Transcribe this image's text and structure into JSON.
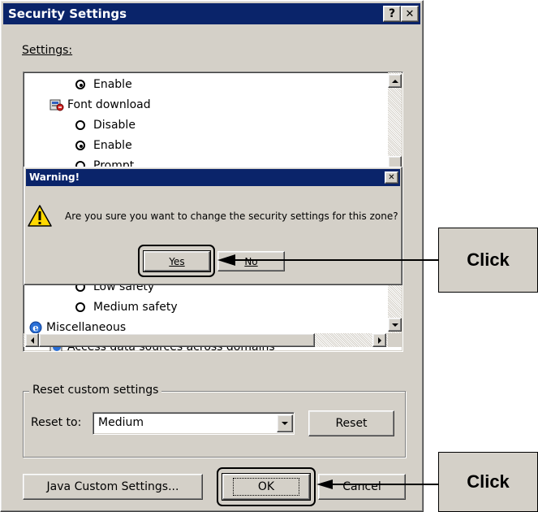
{
  "dialog": {
    "title": "Security Settings",
    "help_glyph": "?",
    "close_glyph": "✕",
    "settings_label": "Settings:",
    "tree": [
      {
        "kind": "radio",
        "label": "Enable",
        "checked": true
      },
      {
        "kind": "category",
        "label": "Font download",
        "icon": "font-download-icon"
      },
      {
        "kind": "radio",
        "label": "Disable",
        "checked": false
      },
      {
        "kind": "radio",
        "label": "Enable",
        "checked": true
      },
      {
        "kind": "radio",
        "label": "Prompt",
        "checked": false
      },
      {
        "kind": "radio",
        "label": "Low safety",
        "checked": false
      },
      {
        "kind": "radio",
        "label": "Medium safety",
        "checked": false
      },
      {
        "kind": "category",
        "label": "Miscellaneous",
        "icon": "ie-icon"
      },
      {
        "kind": "item",
        "label": "Access data sources across domains",
        "icon": "ie-icon"
      }
    ],
    "reset_group_label": "Reset custom settings",
    "reset_to_label": "Reset to:",
    "reset_to_value": "Medium",
    "reset_button": "Reset",
    "java_button": "Java Custom Settings...",
    "ok_button": "OK",
    "cancel_button": "Cancel"
  },
  "warning": {
    "title": "Warning!",
    "close_glyph": "✕",
    "message": "Are you sure you want to change the security settings for this zone?",
    "yes_button": "Yes",
    "no_button": "No",
    "icon": "warning-icon"
  },
  "callouts": {
    "top": "Click",
    "bottom": "Click"
  },
  "colors": {
    "dialog_face": "#d4d0c8",
    "titlebar": "#0a246a",
    "warning_titlebar": "#0a246a",
    "callout_fill": "#d4d0c8",
    "highlight_outline": "#000000"
  }
}
